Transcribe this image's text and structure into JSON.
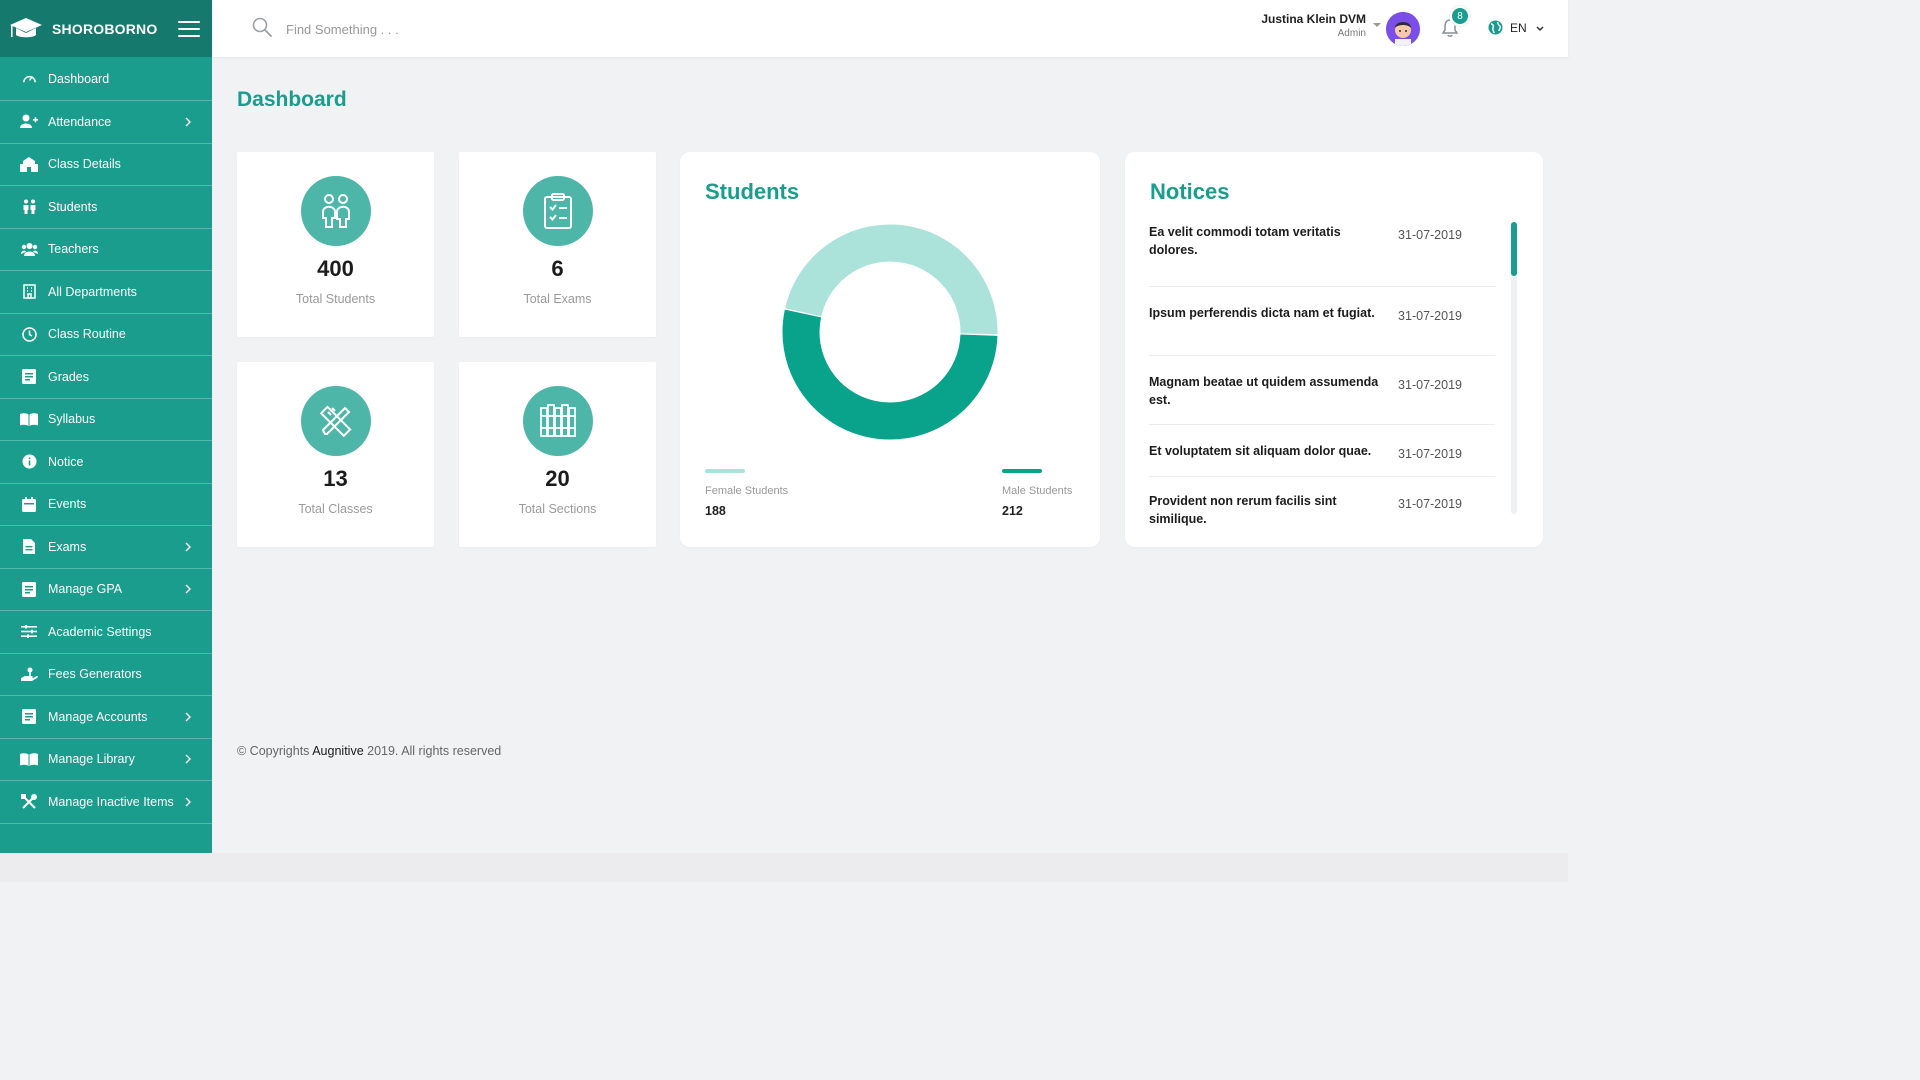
{
  "brand": {
    "name": "SHOROBORNO"
  },
  "sidebar": {
    "items": [
      {
        "label": "Dashboard",
        "icon": "dashboard-icon",
        "has_submenu": false
      },
      {
        "label": "Attendance",
        "icon": "user-plus-icon",
        "has_submenu": true
      },
      {
        "label": "Class Details",
        "icon": "school-icon",
        "has_submenu": false
      },
      {
        "label": "Students",
        "icon": "students-icon",
        "has_submenu": false
      },
      {
        "label": "Teachers",
        "icon": "teachers-icon",
        "has_submenu": false
      },
      {
        "label": "All Departments",
        "icon": "building-icon",
        "has_submenu": false
      },
      {
        "label": "Class Routine",
        "icon": "clock-icon",
        "has_submenu": false
      },
      {
        "label": "Grades",
        "icon": "grades-icon",
        "has_submenu": false
      },
      {
        "label": "Syllabus",
        "icon": "book-open-icon",
        "has_submenu": false
      },
      {
        "label": "Notice",
        "icon": "info-icon",
        "has_submenu": false
      },
      {
        "label": "Events",
        "icon": "calendar-icon",
        "has_submenu": false
      },
      {
        "label": "Exams",
        "icon": "exam-file-icon",
        "has_submenu": true
      },
      {
        "label": "Manage GPA",
        "icon": "gpa-icon",
        "has_submenu": true
      },
      {
        "label": "Academic Settings",
        "icon": "sliders-icon",
        "has_submenu": false
      },
      {
        "label": "Fees Generators",
        "icon": "hand-coin-icon",
        "has_submenu": false
      },
      {
        "label": "Manage Accounts",
        "icon": "accounts-icon",
        "has_submenu": true
      },
      {
        "label": "Manage Library",
        "icon": "library-icon",
        "has_submenu": true
      },
      {
        "label": "Manage Inactive Items",
        "icon": "tools-icon",
        "has_submenu": true
      }
    ]
  },
  "header": {
    "search_placeholder": "Find Something . . .",
    "user_name": "Justina Klein DVM",
    "user_role": "Admin",
    "notification_count": "8",
    "language": "EN"
  },
  "page": {
    "title": "Dashboard"
  },
  "stats": [
    {
      "value": "400",
      "label": "Total Students",
      "icon": "students-pair-icon"
    },
    {
      "value": "6",
      "label": "Total Exams",
      "icon": "clipboard-check-icon"
    },
    {
      "value": "13",
      "label": "Total Classes",
      "icon": "ruler-pencil-icon"
    },
    {
      "value": "20",
      "label": "Total Sections",
      "icon": "books-shelf-icon"
    }
  ],
  "students_panel": {
    "title": "Students",
    "female_label": "Female Students",
    "female_value": "188",
    "male_label": "Male Students",
    "male_value": "212"
  },
  "chart_data": {
    "type": "pie",
    "donut": true,
    "categories": [
      "Female Students",
      "Male Students"
    ],
    "values": [
      188,
      212
    ],
    "colors": [
      "#abe3da",
      "#09a28a"
    ]
  },
  "notices": {
    "title": "Notices",
    "items": [
      {
        "text": "Ea velit commodi totam veritatis dolores.",
        "date": "31-07-2019"
      },
      {
        "text": "Ipsum perferendis dicta nam et fugiat.",
        "date": "31-07-2019"
      },
      {
        "text": "Magnam beatae ut quidem assumenda est.",
        "date": "31-07-2019"
      },
      {
        "text": "Et voluptatem sit aliquam dolor quae.",
        "date": "31-07-2019"
      },
      {
        "text": "Provident non rerum facilis sint similique.",
        "date": "31-07-2019"
      }
    ]
  },
  "footer": {
    "prefix": "© Copyrights ",
    "company": "Augnitive",
    "suffix": " 2019. All rights reserved"
  },
  "colors": {
    "primary": "#1a9d8c",
    "primary_dark": "#157a6d",
    "icon_circle": "#4db6a9",
    "background": "#f1f2f4"
  }
}
